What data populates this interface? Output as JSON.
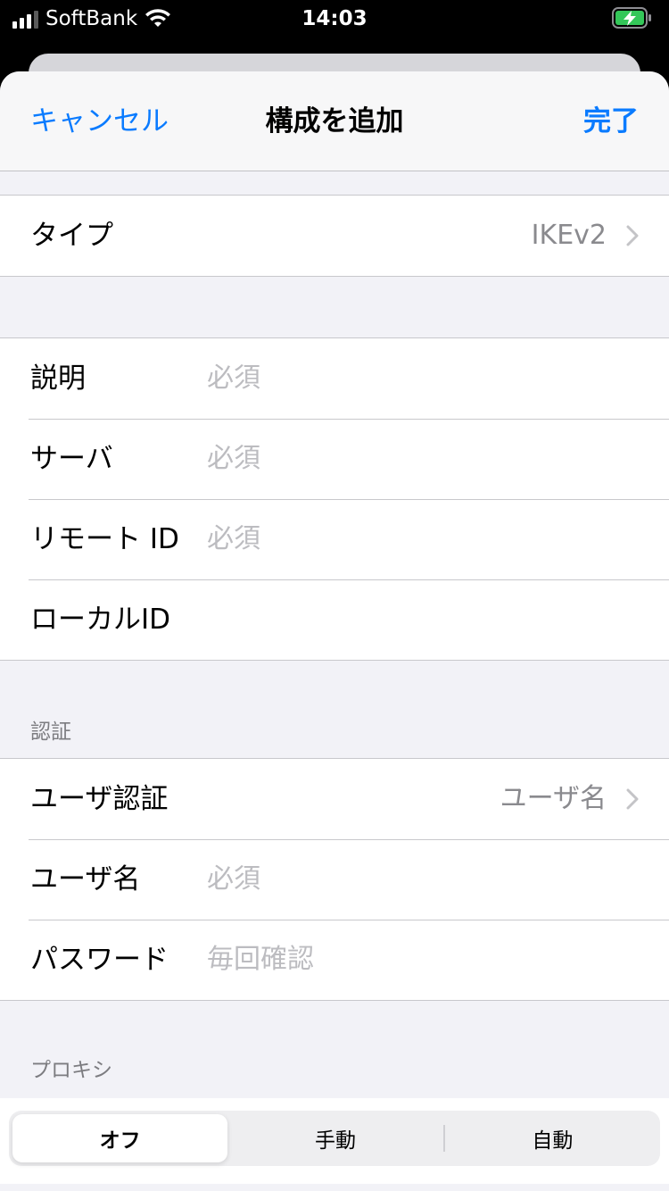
{
  "status_bar": {
    "carrier": "SoftBank",
    "time": "14:03",
    "signal_bars_filled": 3,
    "battery_state": "charging",
    "battery_color": "#34c759"
  },
  "navbar": {
    "cancel_label": "キャンセル",
    "title": "構成を追加",
    "done_label": "完了"
  },
  "type_group": {
    "label": "タイプ",
    "value": "IKEv2"
  },
  "connection_group": {
    "rows": [
      {
        "label": "説明",
        "placeholder": "必須"
      },
      {
        "label": "サーバ",
        "placeholder": "必須"
      },
      {
        "label": "リモート ID",
        "placeholder": "必須"
      },
      {
        "label": "ローカルID",
        "placeholder": ""
      }
    ]
  },
  "auth_section": {
    "header": "認証",
    "user_auth_label": "ユーザ認証",
    "user_auth_value": "ユーザ名",
    "username_label": "ユーザ名",
    "username_placeholder": "必須",
    "password_label": "パスワード",
    "password_placeholder": "毎回確認"
  },
  "proxy_section": {
    "header": "プロキシ",
    "options": [
      "オフ",
      "手動",
      "自動"
    ],
    "selected": "オフ"
  },
  "colors": {
    "accent": "#0a7bff",
    "background": "#f2f2f7",
    "separator": "#c8c8cc",
    "placeholder": "#bcbcc0"
  }
}
